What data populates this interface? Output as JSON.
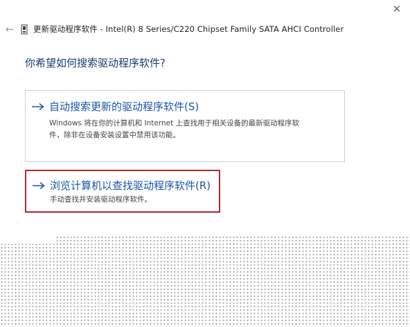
{
  "window": {
    "close_glyph": "✕",
    "back_glyph": "←",
    "title": "更新驱动程序软件 - Intel(R) 8 Series/C220 Chipset Family SATA AHCI Controller"
  },
  "main": {
    "question": "你希望如何搜索驱动程序软件?",
    "options": [
      {
        "title": "自动搜索更新的驱动程序软件(S)",
        "description_line1": "Windows 将在你的计算机和 Internet 上查找用于相关设备的最新驱动程序软",
        "description_line2": "件，除非在设备安装设置中禁用该功能。"
      },
      {
        "title": "浏览计算机以查找驱动程序软件(R)",
        "description_line1": "手动查找并安装驱动程序软件。"
      }
    ]
  },
  "colors": {
    "link_blue": "#1a56a7",
    "question_blue": "#1a3c6e",
    "highlight_red": "#b2272d"
  },
  "icons": {
    "close": "close-icon",
    "back": "back-arrow-icon",
    "device": "device-icon",
    "option_arrow": "right-arrow-icon"
  }
}
